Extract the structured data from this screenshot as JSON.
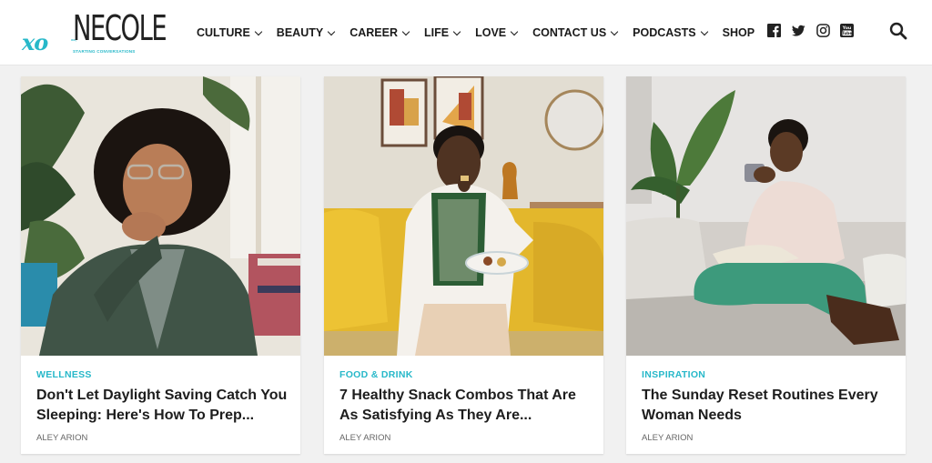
{
  "brand": {
    "logo_prefix": "xo",
    "logo_name": "NECOLE",
    "logo_small": "xo,",
    "tagline": "STARTING CONVERSATIONS",
    "accent": "#27b8c9"
  },
  "nav": {
    "items": [
      {
        "label": "CULTURE",
        "has_dropdown": true
      },
      {
        "label": "BEAUTY",
        "has_dropdown": true
      },
      {
        "label": "CAREER",
        "has_dropdown": true
      },
      {
        "label": "LIFE",
        "has_dropdown": true
      },
      {
        "label": "LOVE",
        "has_dropdown": true
      },
      {
        "label": "CONTACT US",
        "has_dropdown": true
      },
      {
        "label": "PODCASTS",
        "has_dropdown": true
      },
      {
        "label": "SHOP",
        "has_dropdown": false
      }
    ]
  },
  "social": [
    "facebook-icon",
    "twitter-icon",
    "instagram-icon",
    "youtube-icon"
  ],
  "articles": [
    {
      "category": "WELLNESS",
      "title": "Don't Let Daylight Saving Catch You Sleeping: Here's How To Prep...",
      "author": "ALEY ARION"
    },
    {
      "category": "FOOD & DRINK",
      "title": "7 Healthy Snack Combos That Are As Satisfying As They Are...",
      "author": "ALEY ARION"
    },
    {
      "category": "INSPIRATION",
      "title": "The Sunday Reset Routines Every Woman Needs",
      "author": "ALEY ARION"
    }
  ]
}
